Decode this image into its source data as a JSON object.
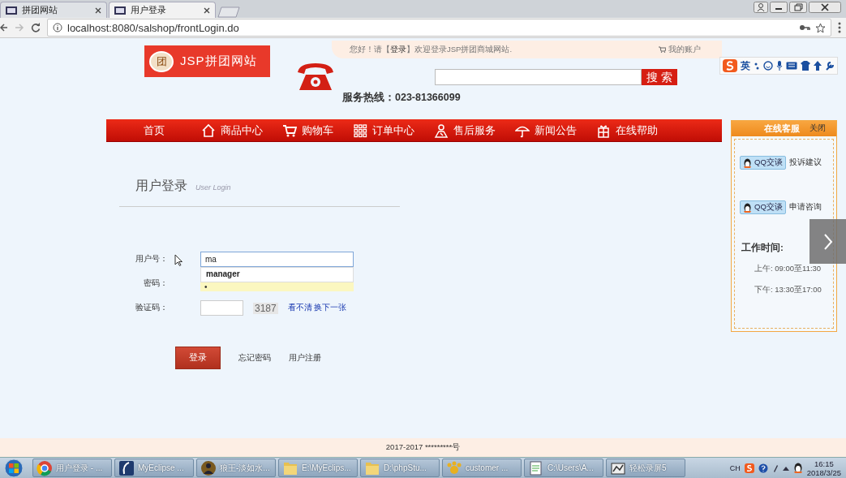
{
  "browser": {
    "tabs": [
      {
        "title": "拼团网站",
        "selected": false
      },
      {
        "title": "用户登录",
        "selected": true
      }
    ],
    "url": "localhost:8080/salshop/frontLogin.do"
  },
  "top_bar": {
    "greeting": "您好！请【**登录**】欢迎登录JSP拼团商城网站.",
    "account": "我的账户"
  },
  "logo": {
    "badge": "团",
    "text": "JSP拼团网站"
  },
  "search": {
    "button": "搜 索"
  },
  "hotline": "服务热线：023-81366099",
  "nav": [
    {
      "label": "首页",
      "kind": "plain"
    },
    {
      "label": "商品中心",
      "kind": "home"
    },
    {
      "label": "购物车",
      "kind": "cart"
    },
    {
      "label": "订单中心",
      "kind": "grid"
    },
    {
      "label": "售后服务",
      "kind": "person"
    },
    {
      "label": "新闻公告",
      "kind": "umbrella"
    },
    {
      "label": "在线帮助",
      "kind": "gift"
    }
  ],
  "login": {
    "title": "用户登录",
    "subtitle": "User Login",
    "username_label": "用户号：",
    "username": "ma",
    "suggestion": "manager",
    "password_label": "密码：",
    "password": "•",
    "captcha_label": "验证码：",
    "captcha": "3187",
    "captcha_link": "看不清 换下一张",
    "submit": "登录",
    "links": [
      "忘记密码",
      "用户注册"
    ]
  },
  "service": {
    "title": "在线客服",
    "close": "关闭",
    "contacts": [
      {
        "button": "QQ交谈",
        "label": "投诉建议"
      },
      {
        "button": "QQ交谈",
        "label": "申请咨询"
      }
    ],
    "hours_title": "工作时间:",
    "hours": [
      "上午: 09:00至11:30",
      "下午: 13:30至17:00"
    ]
  },
  "ime": {
    "mode": "英"
  },
  "footer": "2017-2017 *********号",
  "taskbar": {
    "items": [
      {
        "label": "用户登录 - ...",
        "kind": "chrome"
      },
      {
        "label": "MyEclipse ...",
        "kind": "eclipse"
      },
      {
        "label": "狼王-淡如水...",
        "kind": "avatar"
      },
      {
        "label": "E:\\MyEclips...",
        "kind": "folder"
      },
      {
        "label": "D:\\phpStu...",
        "kind": "folder"
      },
      {
        "label": "customer ...",
        "kind": "paw"
      },
      {
        "label": "C:\\Users\\A...",
        "kind": "notepad"
      },
      {
        "label": "轻松录屏5",
        "kind": "recorder"
      }
    ],
    "lang": "CH",
    "time": "16:15",
    "date": "2018/3/25"
  }
}
